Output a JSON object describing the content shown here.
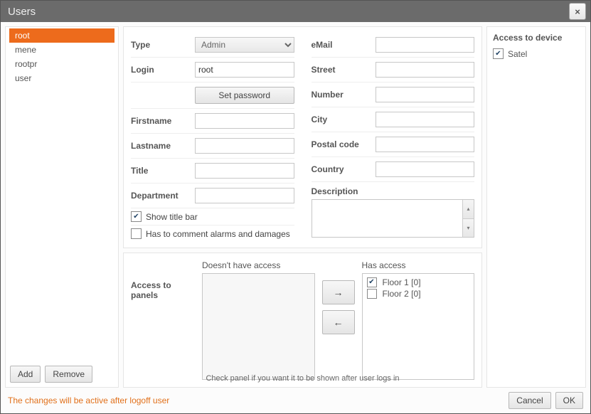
{
  "window": {
    "title": "Users"
  },
  "users": [
    "root",
    "mene",
    "rootpr",
    "user"
  ],
  "selected_user_index": 0,
  "buttons": {
    "add": "Add",
    "remove": "Remove",
    "set_password": "Set password",
    "move_right": "→",
    "move_left": "←",
    "cancel": "Cancel",
    "ok": "OK",
    "close": "×"
  },
  "form": {
    "type_label": "Type",
    "type_value": "Admin",
    "login_label": "Login",
    "login_value": "root",
    "firstname_label": "Firstname",
    "firstname_value": "",
    "lastname_label": "Lastname",
    "lastname_value": "",
    "title_label": "Title",
    "title_value": "",
    "department_label": "Department",
    "department_value": "",
    "show_title_bar_label": "Show title bar",
    "show_title_bar_checked": true,
    "comment_alarms_label": "Has to comment alarms and damages",
    "comment_alarms_checked": false,
    "email_label": "eMail",
    "email_value": "",
    "street_label": "Street",
    "street_value": "",
    "number_label": "Number",
    "number_value": "",
    "city_label": "City",
    "city_value": "",
    "postal_label": "Postal code",
    "postal_value": "",
    "country_label": "Country",
    "country_value": "",
    "description_label": "Description",
    "description_value": ""
  },
  "access_panels": {
    "section_label": "Access to panels",
    "no_access_label": "Doesn't have access",
    "has_access_label": "Has access",
    "no_access_items": [],
    "has_access_items": [
      {
        "label": "Floor 1 [0]",
        "checked": true
      },
      {
        "label": "Floor 2 [0]",
        "checked": false
      }
    ],
    "hint": "Check panel if you want it to be shown after user logs in"
  },
  "device": {
    "header": "Access to device",
    "items": [
      {
        "label": "Satel",
        "checked": true
      }
    ]
  },
  "status_message": "The changes will be active after logoff user"
}
